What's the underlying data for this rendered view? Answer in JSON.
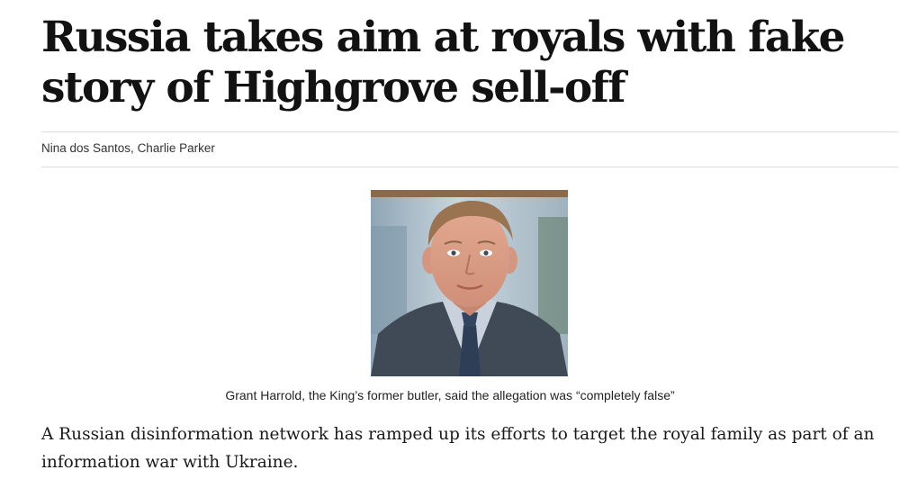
{
  "article": {
    "headline": "Russia takes aim at royals with fake story of Highgrove sell-off",
    "byline": "Nina dos Santos, Charlie Parker",
    "image": {
      "caption": "Grant Harrold, the King’s former butler, said the allegation was “completely false”"
    },
    "body_paragraphs": [
      "A Russian disinformation network has ramped up its efforts to target the royal family as part of an information war with Ukraine."
    ]
  }
}
